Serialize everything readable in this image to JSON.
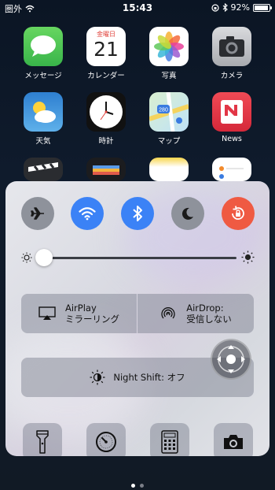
{
  "status": {
    "carrier": "圏外",
    "time": "15:43",
    "battery": "92%",
    "battery_level": 0.92
  },
  "apps": [
    {
      "label": "メッセージ",
      "icon": "messages-icon"
    },
    {
      "label": "カレンダー",
      "icon": "calendar-icon",
      "weekday": "金曜日",
      "day": "21"
    },
    {
      "label": "写真",
      "icon": "photos-icon"
    },
    {
      "label": "カメラ",
      "icon": "camera-icon"
    },
    {
      "label": "天気",
      "icon": "weather-icon"
    },
    {
      "label": "時計",
      "icon": "clock-icon"
    },
    {
      "label": "マップ",
      "icon": "maps-icon",
      "route": "280"
    },
    {
      "label": "News",
      "icon": "news-icon"
    }
  ],
  "control_center": {
    "toggles": [
      {
        "name": "airplane-mode",
        "icon": "airplane-icon",
        "on": false,
        "color": "#8e929b"
      },
      {
        "name": "wifi",
        "icon": "wifi-icon",
        "on": true,
        "color": "#3b82f6"
      },
      {
        "name": "bluetooth",
        "icon": "bluetooth-icon",
        "on": true,
        "color": "#3b82f6"
      },
      {
        "name": "do-not-disturb",
        "icon": "moon-icon",
        "on": false,
        "color": "#8e929b"
      },
      {
        "name": "rotation-lock",
        "icon": "rotation-lock-icon",
        "on": true,
        "color": "#ef5a42"
      }
    ],
    "brightness": 0.0,
    "airplay": {
      "line1": "AirPlay",
      "line2": "ミラーリング"
    },
    "airdrop": {
      "line1": "AirDrop:",
      "line2": "受信しない"
    },
    "night_shift": "Night Shift: オフ",
    "tools": [
      {
        "name": "flashlight",
        "icon": "flashlight-icon"
      },
      {
        "name": "timer",
        "icon": "timer-icon"
      },
      {
        "name": "calculator",
        "icon": "calculator-icon"
      },
      {
        "name": "camera",
        "icon": "camera-icon"
      }
    ]
  },
  "page_dots": {
    "count": 2,
    "active": 0
  }
}
